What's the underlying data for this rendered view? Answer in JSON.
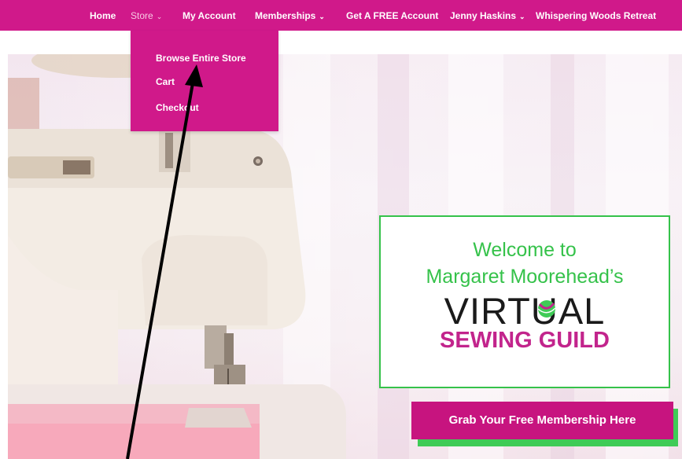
{
  "nav": {
    "items": [
      {
        "label": "Home",
        "has_dropdown": false,
        "active": false
      },
      {
        "label": "Store",
        "has_dropdown": true,
        "active": true
      },
      {
        "label": "My Account",
        "has_dropdown": false,
        "active": false
      },
      {
        "label": "Memberships",
        "has_dropdown": true,
        "active": false
      },
      {
        "label": "Get A FREE Account",
        "has_dropdown": false,
        "active": false
      },
      {
        "label": "Jenny Haskins",
        "has_dropdown": true,
        "active": false
      },
      {
        "label": "Whispering Woods Retreat",
        "has_dropdown": false,
        "active": false
      }
    ],
    "chevron": "⌄"
  },
  "store_dropdown": {
    "items": [
      {
        "label": "Browse Entire Store"
      },
      {
        "label": "Cart"
      },
      {
        "label": "Checkout"
      }
    ]
  },
  "welcome": {
    "line1": "Welcome to",
    "line2": "Margaret Moorehead’s",
    "logo_word": "VIRTUAL",
    "logo_sub": "SEWING GUILD"
  },
  "cta": {
    "label": "Grab Your Free Membership Here"
  },
  "colors": {
    "brand_magenta": "#d0198a",
    "accent_green": "#35c24a",
    "logo_pink": "#c2248c"
  },
  "icons": [
    "chevron-down-icon",
    "thread-spool-icon",
    "annotation-arrow"
  ]
}
